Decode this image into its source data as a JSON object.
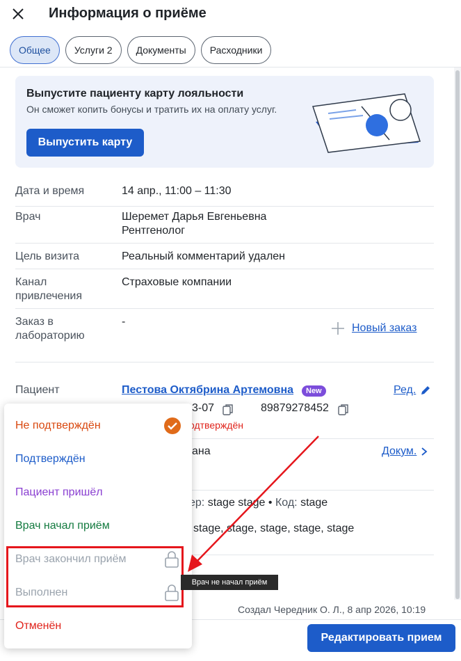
{
  "header": {
    "title": "Информация о приёме"
  },
  "tabs": [
    {
      "label": "Общее"
    },
    {
      "label": "Услуги 2"
    },
    {
      "label": "Документы"
    },
    {
      "label": "Расходники"
    }
  ],
  "promo": {
    "title": "Выпустите пациенту карту лояльности",
    "subtitle": "Он сможет копить бонусы и тратить их на оплату услуг.",
    "button": "Выпустить карту"
  },
  "details": {
    "datetime_label": "Дата и время",
    "datetime_value": "14 апр., 11:00 – 11:30",
    "doctor_label": "Врач",
    "doctor_name": "Шеремет Дарья Евгеньевна",
    "doctor_role": "Рентгенолог",
    "purpose_label": "Цель визита",
    "purpose_value": "Реальный комментарий удален",
    "channel_label_1": "Канал",
    "channel_label_2": "привлечения",
    "channel_value": "Страховые компании",
    "lab_label_1": "Заказ в",
    "lab_label_2": "лабораторию",
    "lab_value": "-",
    "new_order": "Новый заказ"
  },
  "patient": {
    "label": "Пациент",
    "name": "Пестова Октябрина Артемовна",
    "badge": "New",
    "edit": "Ред.",
    "birth_partial": "3-07",
    "phone": "89879278452",
    "status_partial": "одтверждён",
    "line3_partial": "ана",
    "docs_link": "Докум.",
    "stage_prefix": "ер:",
    "stage_value": "stage stage",
    "bullet": "•",
    "code_label": "Код:",
    "code_value": "stage",
    "stages": "stage, stage, stage, stage, stage"
  },
  "footer": {
    "created": "Создал Чередник О. Л., 8 апр 2026, 10:19",
    "edit_button": "Редактировать прием"
  },
  "status_menu": [
    {
      "label": "Не подтверждён",
      "color": "#d9480f"
    },
    {
      "label": "Подтверждён",
      "color": "#1d5cc9"
    },
    {
      "label": "Пациент пришёл",
      "color": "#8a3fd1"
    },
    {
      "label": "Врач начал приём",
      "color": "#137a3f"
    },
    {
      "label": "Врач закончил приём",
      "color": "#9aa3ad"
    },
    {
      "label": "Выполнен",
      "color": "#9aa3ad"
    },
    {
      "label": "Отменён",
      "color": "#e0231b"
    }
  ],
  "tooltip": "Врач не начал приём",
  "colors": {
    "accent": "#1d5cc9",
    "highlight": "#e5161c"
  }
}
